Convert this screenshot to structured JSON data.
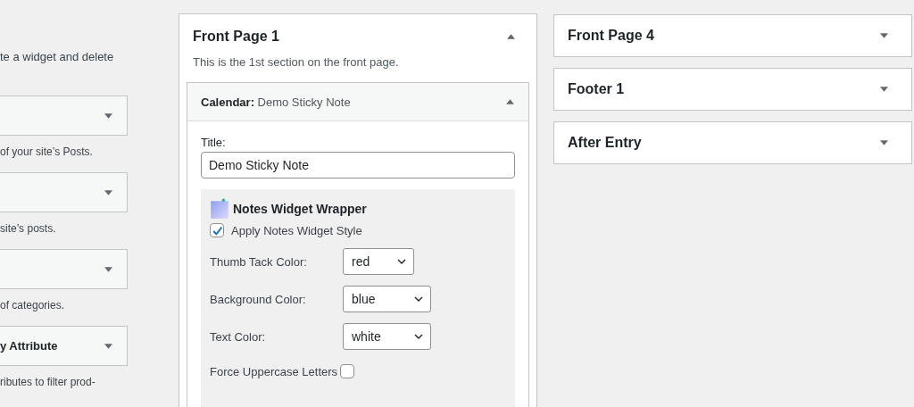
{
  "available_widgets": {
    "intro": "te a widget and delete",
    "items": [
      {
        "description": "of your site’s Posts."
      },
      {
        "description": "site’s posts."
      },
      {
        "description": "of categories."
      },
      {
        "title": "y Attribute",
        "description": "ributes to filter prod-"
      }
    ]
  },
  "areas_main": {
    "title": "Front Page 1",
    "expanded": true,
    "description": "This is the 1st section on the front page.",
    "widget": {
      "type": "Calendar:",
      "name": "Demo Sticky Note",
      "expanded": true,
      "title_label": "Title:",
      "title_value": "Demo Sticky Note",
      "wrapper": {
        "heading": "Notes Widget Wrapper",
        "apply_label": "Apply Notes Widget Style",
        "apply_checked": true,
        "fields": [
          {
            "kind": "select",
            "label": "Thumb Tack Color:",
            "value": "red"
          },
          {
            "kind": "select",
            "label": "Background Color:",
            "value": "blue"
          },
          {
            "kind": "select",
            "label": "Text Color:",
            "value": "white"
          },
          {
            "kind": "checkbox",
            "label": "Force Uppercase Letters",
            "checked": false
          }
        ]
      }
    }
  },
  "areas_side": [
    {
      "title": "Front Page 4",
      "expanded": false
    },
    {
      "title": "Footer 1",
      "expanded": false
    },
    {
      "title": "After Entry",
      "expanded": false
    }
  ]
}
